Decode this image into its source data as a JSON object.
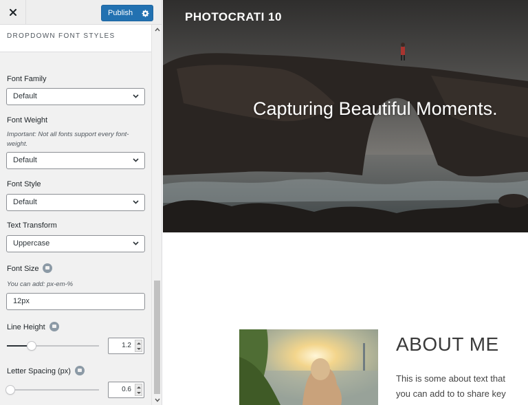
{
  "topbar": {
    "close_label": "Close",
    "publish_label": "Publish"
  },
  "section": {
    "title": "DROPDOWN FONT STYLES"
  },
  "fields": {
    "font_family": {
      "label": "Font Family",
      "value": "Default"
    },
    "font_weight": {
      "label": "Font Weight",
      "description": "Important: Not all fonts support every font-weight.",
      "value": "Default"
    },
    "font_style": {
      "label": "Font Style",
      "value": "Default"
    },
    "text_transform": {
      "label": "Text Transform",
      "value": "Uppercase"
    },
    "font_size": {
      "label": "Font Size",
      "description": "You can add: px-em-%",
      "value": "12px"
    },
    "line_height": {
      "label": "Line Height",
      "value": "1.2",
      "slider_fraction": 0.27
    },
    "letter_spacing": {
      "label": "Letter Spacing (px)",
      "value": "0.6",
      "slider_fraction": 0.04
    }
  },
  "preview": {
    "site_title": "PHOTOCRATI 10",
    "tagline": "Capturing Beautiful Moments.",
    "about_heading": "ABOUT ME",
    "about_line1": "This is some about text that",
    "about_line2": "you can add to to share key"
  },
  "colors": {
    "accent": "#2271b1",
    "panel_bg": "#f1f1f1"
  },
  "icons": {
    "close": "close-icon",
    "settings": "gear-icon",
    "help": "help-icon",
    "dropdown": "chevron-down-icon"
  }
}
